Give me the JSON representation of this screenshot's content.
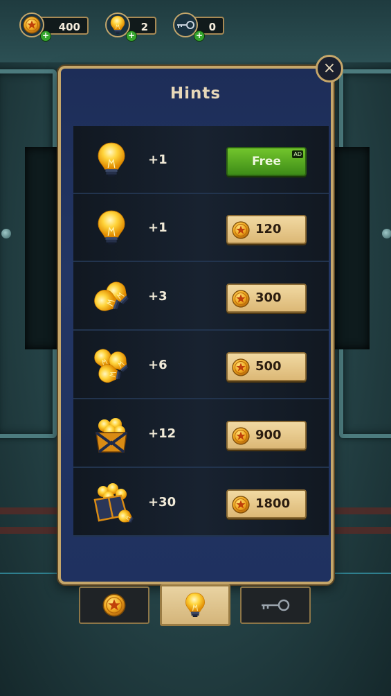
{
  "currencies": [
    {
      "name": "coins",
      "value": "400",
      "icon": "coin-icon"
    },
    {
      "name": "hints",
      "value": "2",
      "icon": "bulb-icon"
    },
    {
      "name": "keys",
      "value": "0",
      "icon": "key-icon"
    }
  ],
  "panel": {
    "title": "Hints",
    "close_label": "×"
  },
  "offers": [
    {
      "icon": "bulb-icon",
      "amount": "+1",
      "type": "free",
      "label": "Free",
      "badge": "AD"
    },
    {
      "icon": "bulb-icon",
      "amount": "+1",
      "type": "coins",
      "price": "120"
    },
    {
      "icon": "bulb-pair-icon",
      "amount": "+3",
      "type": "coins",
      "price": "300"
    },
    {
      "icon": "bulb-trio-icon",
      "amount": "+6",
      "type": "coins",
      "price": "500"
    },
    {
      "icon": "bulb-box-icon",
      "amount": "+12",
      "type": "coins",
      "price": "900"
    },
    {
      "icon": "bulb-chest-icon",
      "amount": "+30",
      "type": "coins",
      "price": "1800"
    }
  ],
  "tabs": [
    {
      "name": "coins",
      "icon": "coin-icon",
      "active": false
    },
    {
      "name": "hints",
      "icon": "bulb-icon",
      "active": true
    },
    {
      "name": "keys",
      "icon": "key-icon",
      "active": false
    }
  ],
  "colors": {
    "panel_bg": "#233664",
    "gold_border": "#c5a66a",
    "free_green": "#5aa822",
    "price_button": "#e8c98c"
  }
}
